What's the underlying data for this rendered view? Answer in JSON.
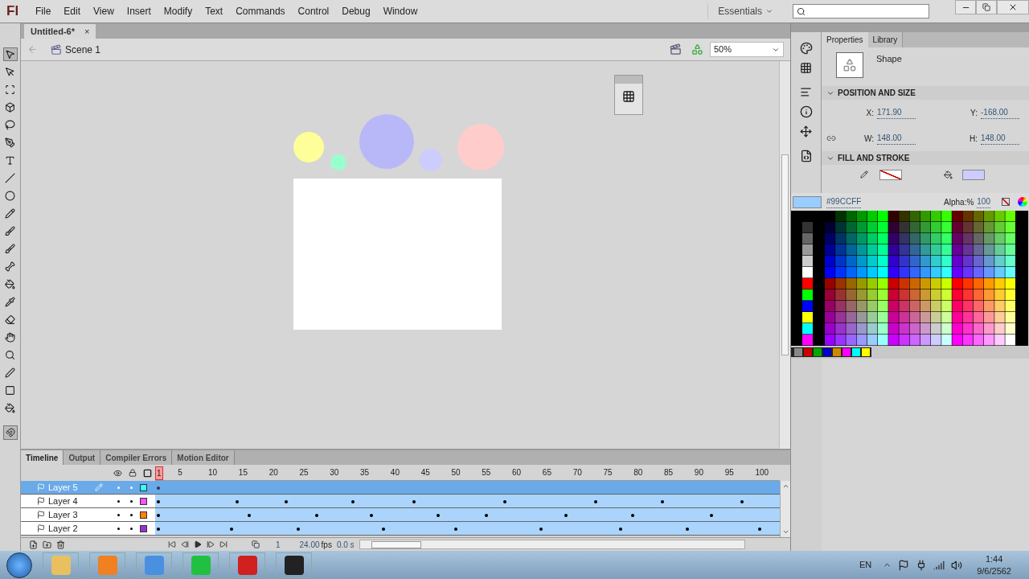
{
  "app": {
    "logo": "Fl"
  },
  "menu": [
    "File",
    "Edit",
    "View",
    "Insert",
    "Modify",
    "Text",
    "Commands",
    "Control",
    "Debug",
    "Window"
  ],
  "workspace": "Essentials",
  "document_tab": {
    "title": "Untitled-6*",
    "close": "×"
  },
  "scene": "Scene 1",
  "zoom": "50%",
  "timeline": {
    "tabs": [
      {
        "label": "Timeline",
        "selected": true
      },
      {
        "label": "Output",
        "selected": false
      },
      {
        "label": "Compiler Errors",
        "selected": false
      },
      {
        "label": "Motion Editor",
        "selected": false
      }
    ],
    "ruler": [
      "1",
      "5",
      "10",
      "15",
      "20",
      "25",
      "30",
      "35",
      "40",
      "45",
      "50",
      "55",
      "60",
      "65",
      "70",
      "75",
      "80",
      "85",
      "90",
      "95",
      "100"
    ],
    "layers": [
      {
        "name": "Layer 5",
        "selected": true,
        "color": "#33ffff"
      },
      {
        "name": "Layer 4",
        "selected": false,
        "color": "#ff4fff"
      },
      {
        "name": "Layer 3",
        "selected": false,
        "color": "#ff800a"
      },
      {
        "name": "Layer 2",
        "selected": false,
        "color": "#9933cc"
      }
    ],
    "frame": "1",
    "fps": "24.00",
    "fps_unit": "fps",
    "time": "0.0 s"
  },
  "properties": {
    "tabs": [
      {
        "label": "Properties",
        "selected": true
      },
      {
        "label": "Library",
        "selected": false
      }
    ],
    "object_type": "Shape",
    "position_title": "POSITION AND SIZE",
    "fields": [
      {
        "label": "X:",
        "value": "171.90"
      },
      {
        "label": "Y:",
        "value": "-168.00"
      },
      {
        "label": "W:",
        "value": "148.00"
      },
      {
        "label": "H:",
        "value": "148.00"
      }
    ],
    "fill_title": "FILL AND STROKE",
    "hex": "#99CCFF",
    "alpha_label": "Alpha:%",
    "alpha": "100"
  },
  "tray": {
    "language": "EN",
    "time": "1:44",
    "date": "9/6/2562"
  }
}
